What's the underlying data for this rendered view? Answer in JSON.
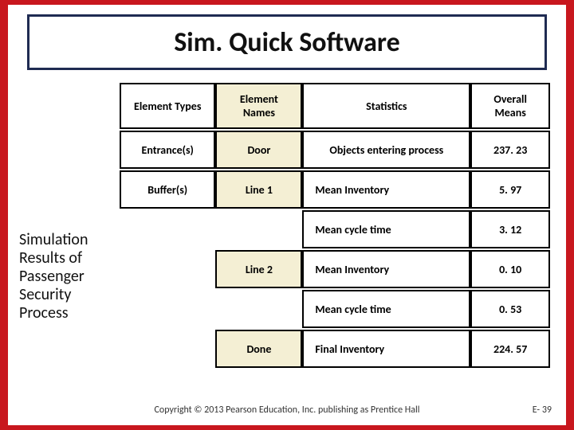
{
  "title": "Sim. Quick Software",
  "side_caption": "Simulation Results of Passenger Security Process",
  "headers": {
    "type": "Element Types",
    "name": "Element Names",
    "stat": "Statistics",
    "mean": "Overall Means"
  },
  "rows": [
    {
      "type": "Entrance(s)",
      "name": "Door",
      "stat": "Objects entering process",
      "stat_align": "center",
      "mean": "237. 23"
    },
    {
      "type": "Buffer(s)",
      "name": "Line 1",
      "stat": "Mean Inventory",
      "stat_align": "left",
      "mean": "5. 97"
    },
    {
      "type": "",
      "name": "",
      "stat": "Mean cycle time",
      "stat_align": "left",
      "mean": "3. 12"
    },
    {
      "type": "",
      "name": "Line 2",
      "stat": "Mean Inventory",
      "stat_align": "left",
      "mean": "0. 10"
    },
    {
      "type": "",
      "name": "",
      "stat": "Mean cycle time",
      "stat_align": "left",
      "mean": "0. 53"
    },
    {
      "type": "",
      "name": "Done",
      "stat": "Final Inventory",
      "stat_align": "left",
      "mean": "224. 57"
    }
  ],
  "footer": "Copyright © 2013 Pearson Education, Inc. publishing as Prentice Hall",
  "page_num": "E- 39"
}
